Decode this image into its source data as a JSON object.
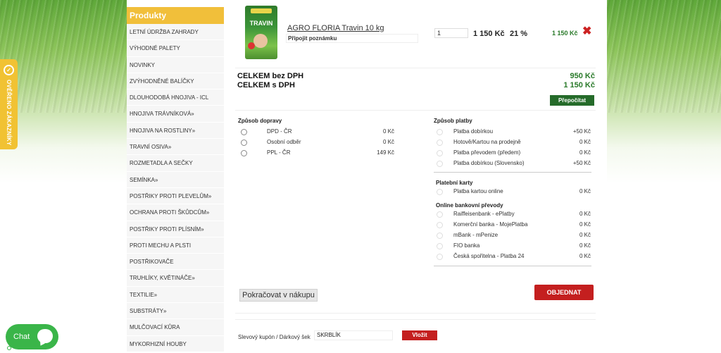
{
  "verified_badge": {
    "text": "OVĚŘENO ZÁKAZNÍKY",
    "icon": "verified-shield-icon"
  },
  "sidebar": {
    "title": "Produkty",
    "items": [
      "LETNÍ ÚDRŽBA ZAHRADY",
      "VÝHODNÉ PALETY",
      "NOVINKY",
      "ZVÝHODNĚNÉ BALÍČKY",
      "DLOUHODOBÁ HNOJIVA - ICL",
      "HNOJIVA TRÁVNÍKOVÁ»",
      "HNOJIVA NA ROSTLINY»",
      "TRAVNÍ OSIVA»",
      "ROZMETADLA A SEČKY",
      "SEMÍNKA»",
      "POSTŘIKY PROTI PLEVELŮM»",
      "OCHRANA PROTI ŠKŮDCŮM»",
      "POSTŘIKY PROTI PLÍSNÍM»",
      "PROTI MECHU A PLSTI",
      "POSTŘIKOVAČE",
      "TRUHLÍKY, KVĚTINÁČE»",
      "TEXTILIE»",
      "SUBSTRÁTY»",
      "MULČOVACÍ KŮRA",
      "MYKORHIZNÍ HOUBY"
    ]
  },
  "cart": {
    "product_image_title": "TRAVIN",
    "product_name": "AGRO FLORIA Travin 10 kg",
    "note_label": "Připojit poznámku",
    "quantity": "1",
    "unit_price": "1 150 Kč",
    "vat": "21 %",
    "line_total": "1 150 Kč",
    "remove_icon": "close-x-icon"
  },
  "totals": {
    "without_vat_label": "CELKEM bez DPH",
    "with_vat_label": "CELKEM s DPH",
    "without_vat_value": "950 Kč",
    "with_vat_value": "1 150 Kč",
    "recalc_label": "Přepočítat"
  },
  "shipping": {
    "title": "Způsob dopravy",
    "options": [
      {
        "label": "DPD - ČR",
        "price": "0 Kč"
      },
      {
        "label": "Osobní odběr",
        "price": "0 Kč"
      },
      {
        "label": "PPL - ČR",
        "price": "149 Kč"
      }
    ]
  },
  "payment": {
    "title": "Způsob platby",
    "options": [
      {
        "label": "Platba dobírkou",
        "price": "+50 Kč"
      },
      {
        "label": "Hotově/Kartou na prodejně",
        "price": "0 Kč"
      },
      {
        "label": "Platba převodem (předem)",
        "price": "0 Kč"
      },
      {
        "label": "Platba dobírkou (Slovensko)",
        "price": "+50 Kč"
      }
    ],
    "cards_title": "Platební karty",
    "cards": [
      {
        "label": "Platba kartou online",
        "price": "0 Kč"
      }
    ],
    "bank_title": "Online bankovní převody",
    "banks": [
      {
        "label": "Raiffeisenbank - ePlatby",
        "price": "0 Kč"
      },
      {
        "label": "Komerční banka - MojePlatba",
        "price": "0 Kč"
      },
      {
        "label": "mBank - mPenize",
        "price": "0 Kč"
      },
      {
        "label": "FIO banka",
        "price": "0 Kč"
      },
      {
        "label": "Česká spořitelna - Platba 24",
        "price": "0 Kč"
      }
    ]
  },
  "actions": {
    "continue_label": "Pokračovat v nákupu",
    "order_label": "OBJEDNAT"
  },
  "coupon": {
    "label": "Slevový kupón / Dárkový šek",
    "value": "SKRBLÍK",
    "apply_label": "Vložit"
  },
  "chat": {
    "label": "Chat",
    "icon": "chat-bubble-icon"
  },
  "colors": {
    "sidebar_header": "#f1bf3a",
    "price_green": "#2a7a2a",
    "order_red": "#c41f1f",
    "recalc_green": "#256b2a",
    "chat_green": "#3ab549"
  }
}
